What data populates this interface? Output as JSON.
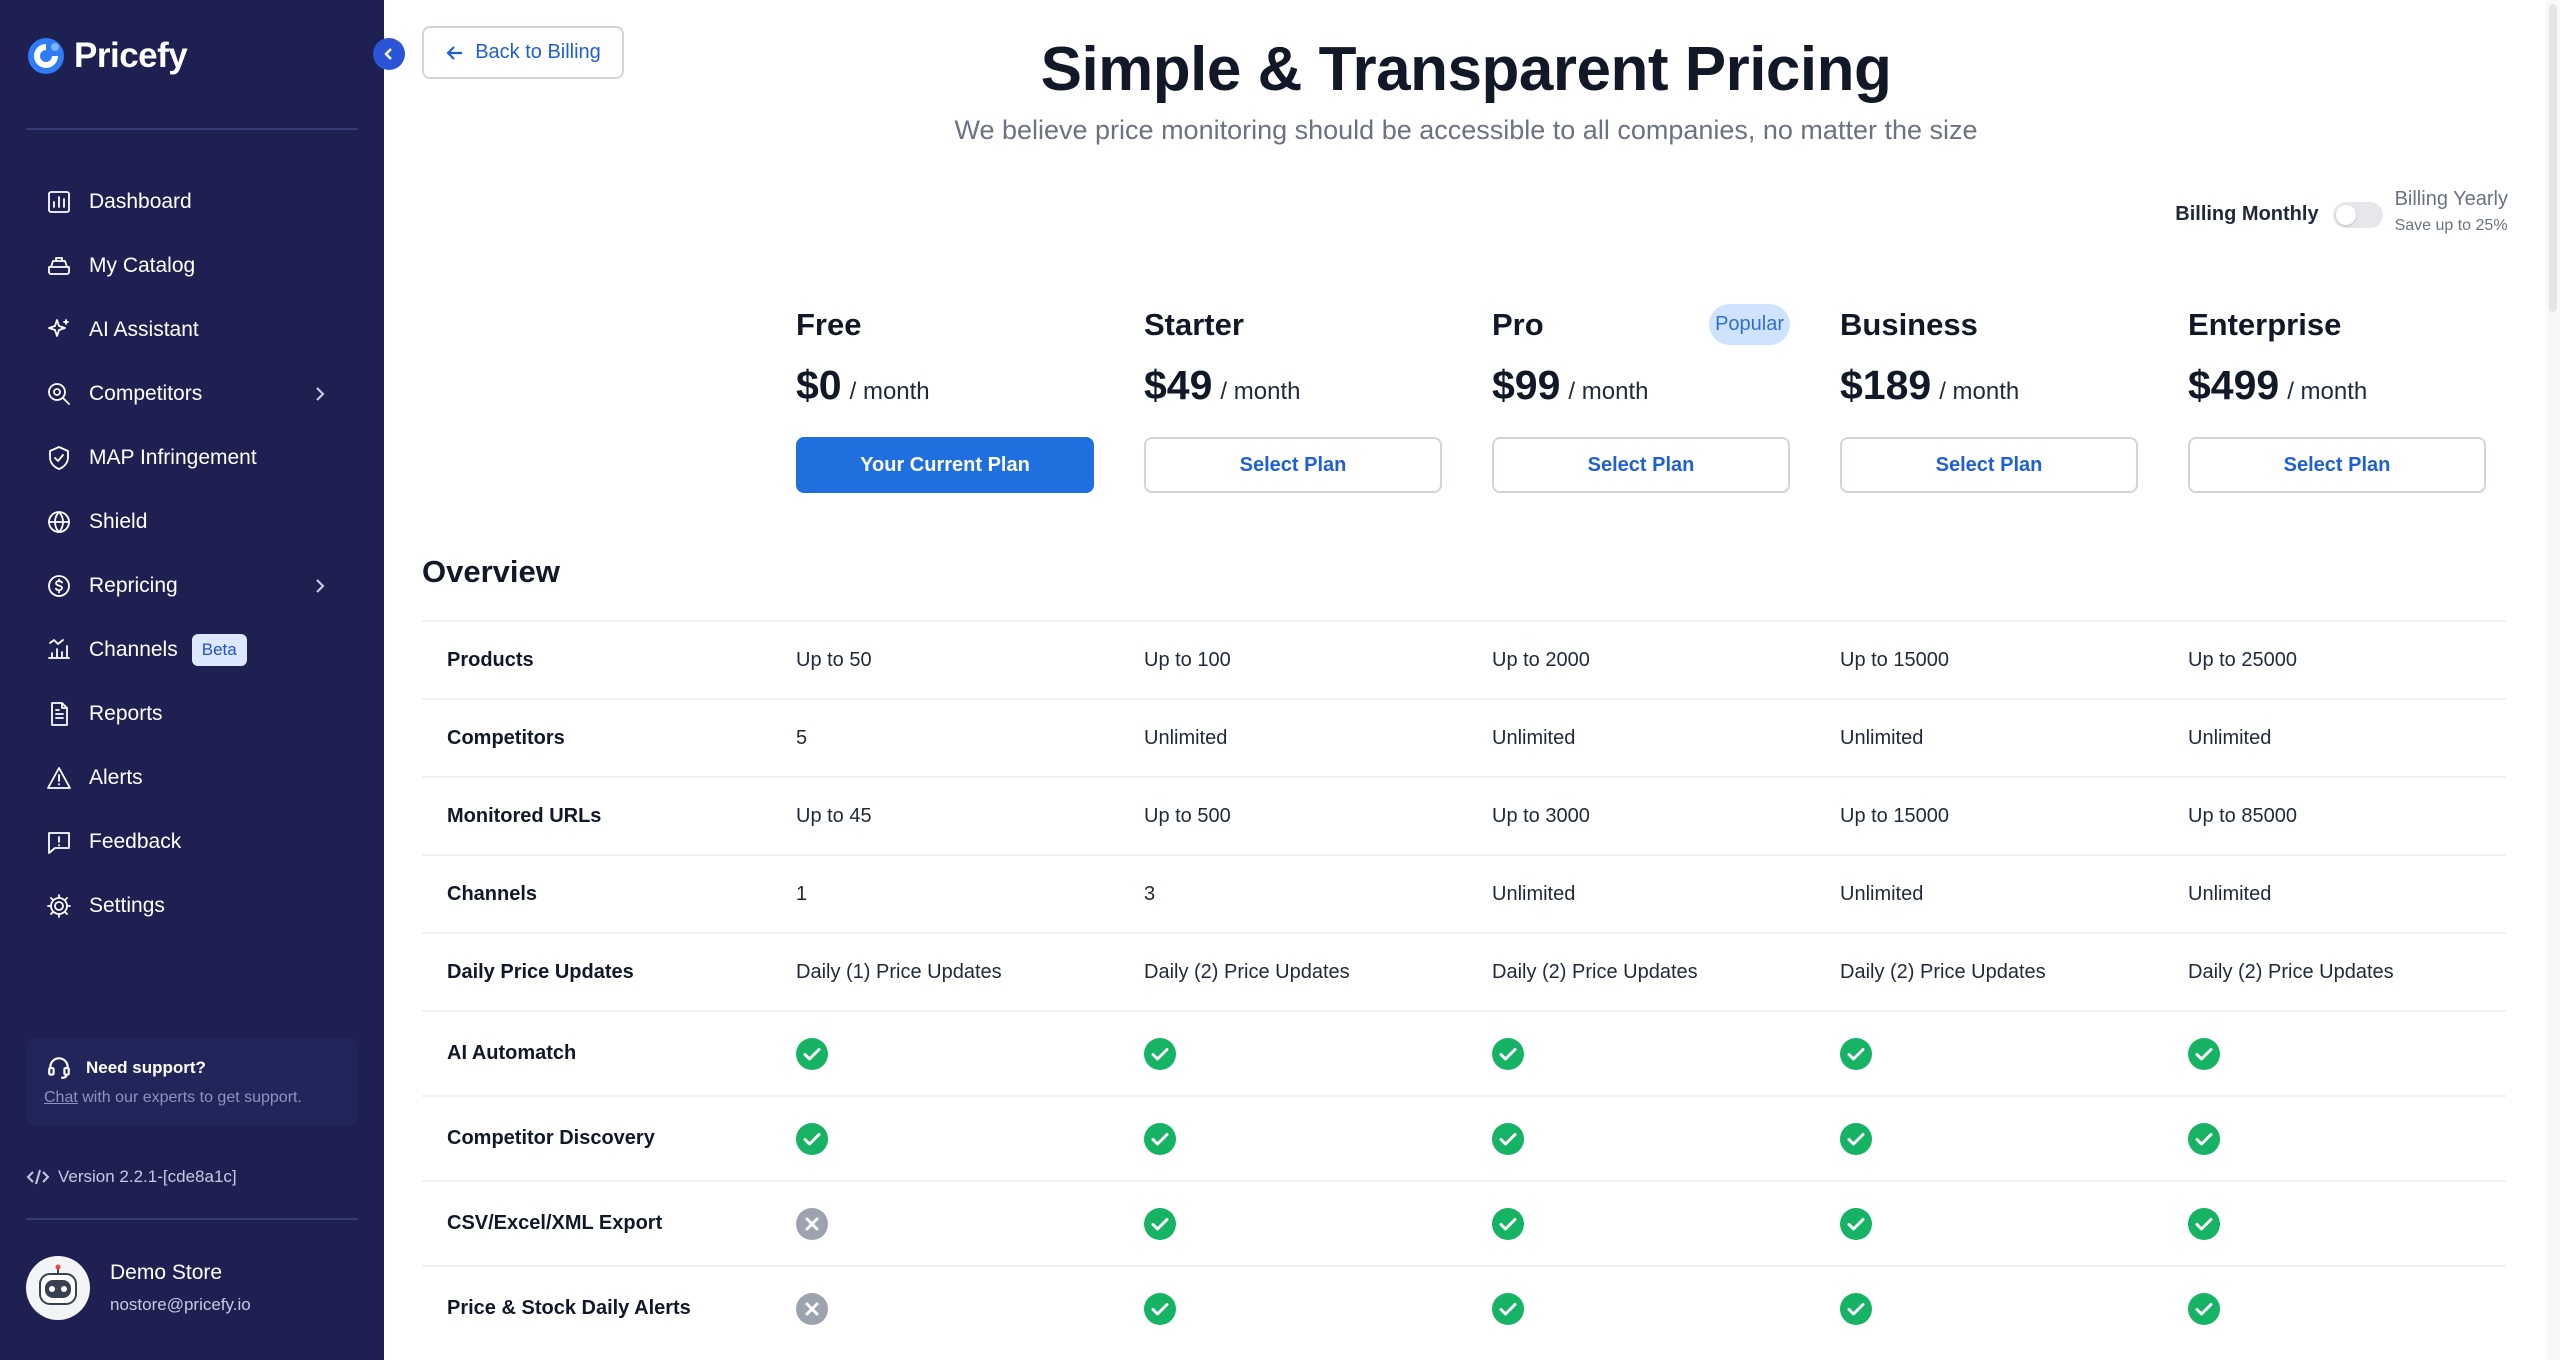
{
  "brand": {
    "name": "Pricefy"
  },
  "nav": {
    "items": [
      {
        "label": "Dashboard",
        "icon": "dashboard-icon"
      },
      {
        "label": "My Catalog",
        "icon": "catalog-icon"
      },
      {
        "label": "AI Assistant",
        "icon": "sparkle-icon"
      },
      {
        "label": "Competitors",
        "icon": "competitors-icon",
        "expandable": true
      },
      {
        "label": "MAP Infringement",
        "icon": "shield-check-icon"
      },
      {
        "label": "Shield",
        "icon": "globe-icon"
      },
      {
        "label": "Repricing",
        "icon": "repricing-icon",
        "expandable": true
      },
      {
        "label": "Channels",
        "icon": "channels-icon",
        "badge": "Beta"
      },
      {
        "label": "Reports",
        "icon": "report-icon"
      },
      {
        "label": "Alerts",
        "icon": "alert-icon"
      },
      {
        "label": "Feedback",
        "icon": "feedback-icon"
      },
      {
        "label": "Settings",
        "icon": "gear-icon"
      }
    ]
  },
  "support": {
    "title": "Need support?",
    "link": "Chat",
    "text": " with our experts to get support."
  },
  "version": "Version 2.2.1-[cde8a1c]",
  "user": {
    "name": "Demo Store",
    "email": "nostore@pricefy.io"
  },
  "header": {
    "back_label": "Back to Billing",
    "title": "Simple & Transparent Pricing",
    "subtitle": "We believe price monitoring should be accessible to all companies, no matter the size"
  },
  "billing": {
    "monthly_label": "Billing Monthly",
    "yearly_label": "Billing Yearly",
    "save_label": "Save up to 25%",
    "yearly_selected": false
  },
  "popular_label": "Popular",
  "plans": [
    {
      "name": "Free",
      "price": "$0",
      "period": "/ month",
      "button": "Your Current Plan",
      "current": true
    },
    {
      "name": "Starter",
      "price": "$49",
      "period": "/ month",
      "button": "Select Plan",
      "current": false
    },
    {
      "name": "Pro",
      "price": "$99",
      "period": "/ month",
      "button": "Select Plan",
      "current": false,
      "popular": true
    },
    {
      "name": "Business",
      "price": "$189",
      "period": "/ month",
      "button": "Select Plan",
      "current": false
    },
    {
      "name": "Enterprise",
      "price": "$499",
      "period": "/ month",
      "button": "Select Plan",
      "current": false
    }
  ],
  "overview_title": "Overview",
  "features": [
    {
      "label": "Products",
      "values": [
        "Up to 50",
        "Up to 100",
        "Up to 2000",
        "Up to 15000",
        "Up to 25000"
      ]
    },
    {
      "label": "Competitors",
      "values": [
        "5",
        "Unlimited",
        "Unlimited",
        "Unlimited",
        "Unlimited"
      ]
    },
    {
      "label": "Monitored URLs",
      "values": [
        "Up to 45",
        "Up to 500",
        "Up to 3000",
        "Up to 15000",
        "Up to 85000"
      ]
    },
    {
      "label": "Channels",
      "values": [
        "1",
        "3",
        "Unlimited",
        "Unlimited",
        "Unlimited"
      ]
    },
    {
      "label": "Daily Price Updates",
      "values": [
        "Daily (1) Price Updates",
        "Daily (2) Price Updates",
        "Daily (2) Price Updates",
        "Daily (2) Price Updates",
        "Daily (2) Price Updates"
      ]
    },
    {
      "label": "AI Automatch",
      "values": [
        true,
        true,
        true,
        true,
        true
      ]
    },
    {
      "label": "Competitor Discovery",
      "values": [
        true,
        true,
        true,
        true,
        true
      ]
    },
    {
      "label": "CSV/Excel/XML Export",
      "values": [
        false,
        true,
        true,
        true,
        true
      ]
    },
    {
      "label": "Price & Stock Daily Alerts",
      "values": [
        false,
        true,
        true,
        true,
        true
      ]
    }
  ],
  "colors": {
    "sidebar": "#1e2052",
    "accent": "#1f6fde",
    "check": "#16b364",
    "cross": "#9ca3af"
  }
}
